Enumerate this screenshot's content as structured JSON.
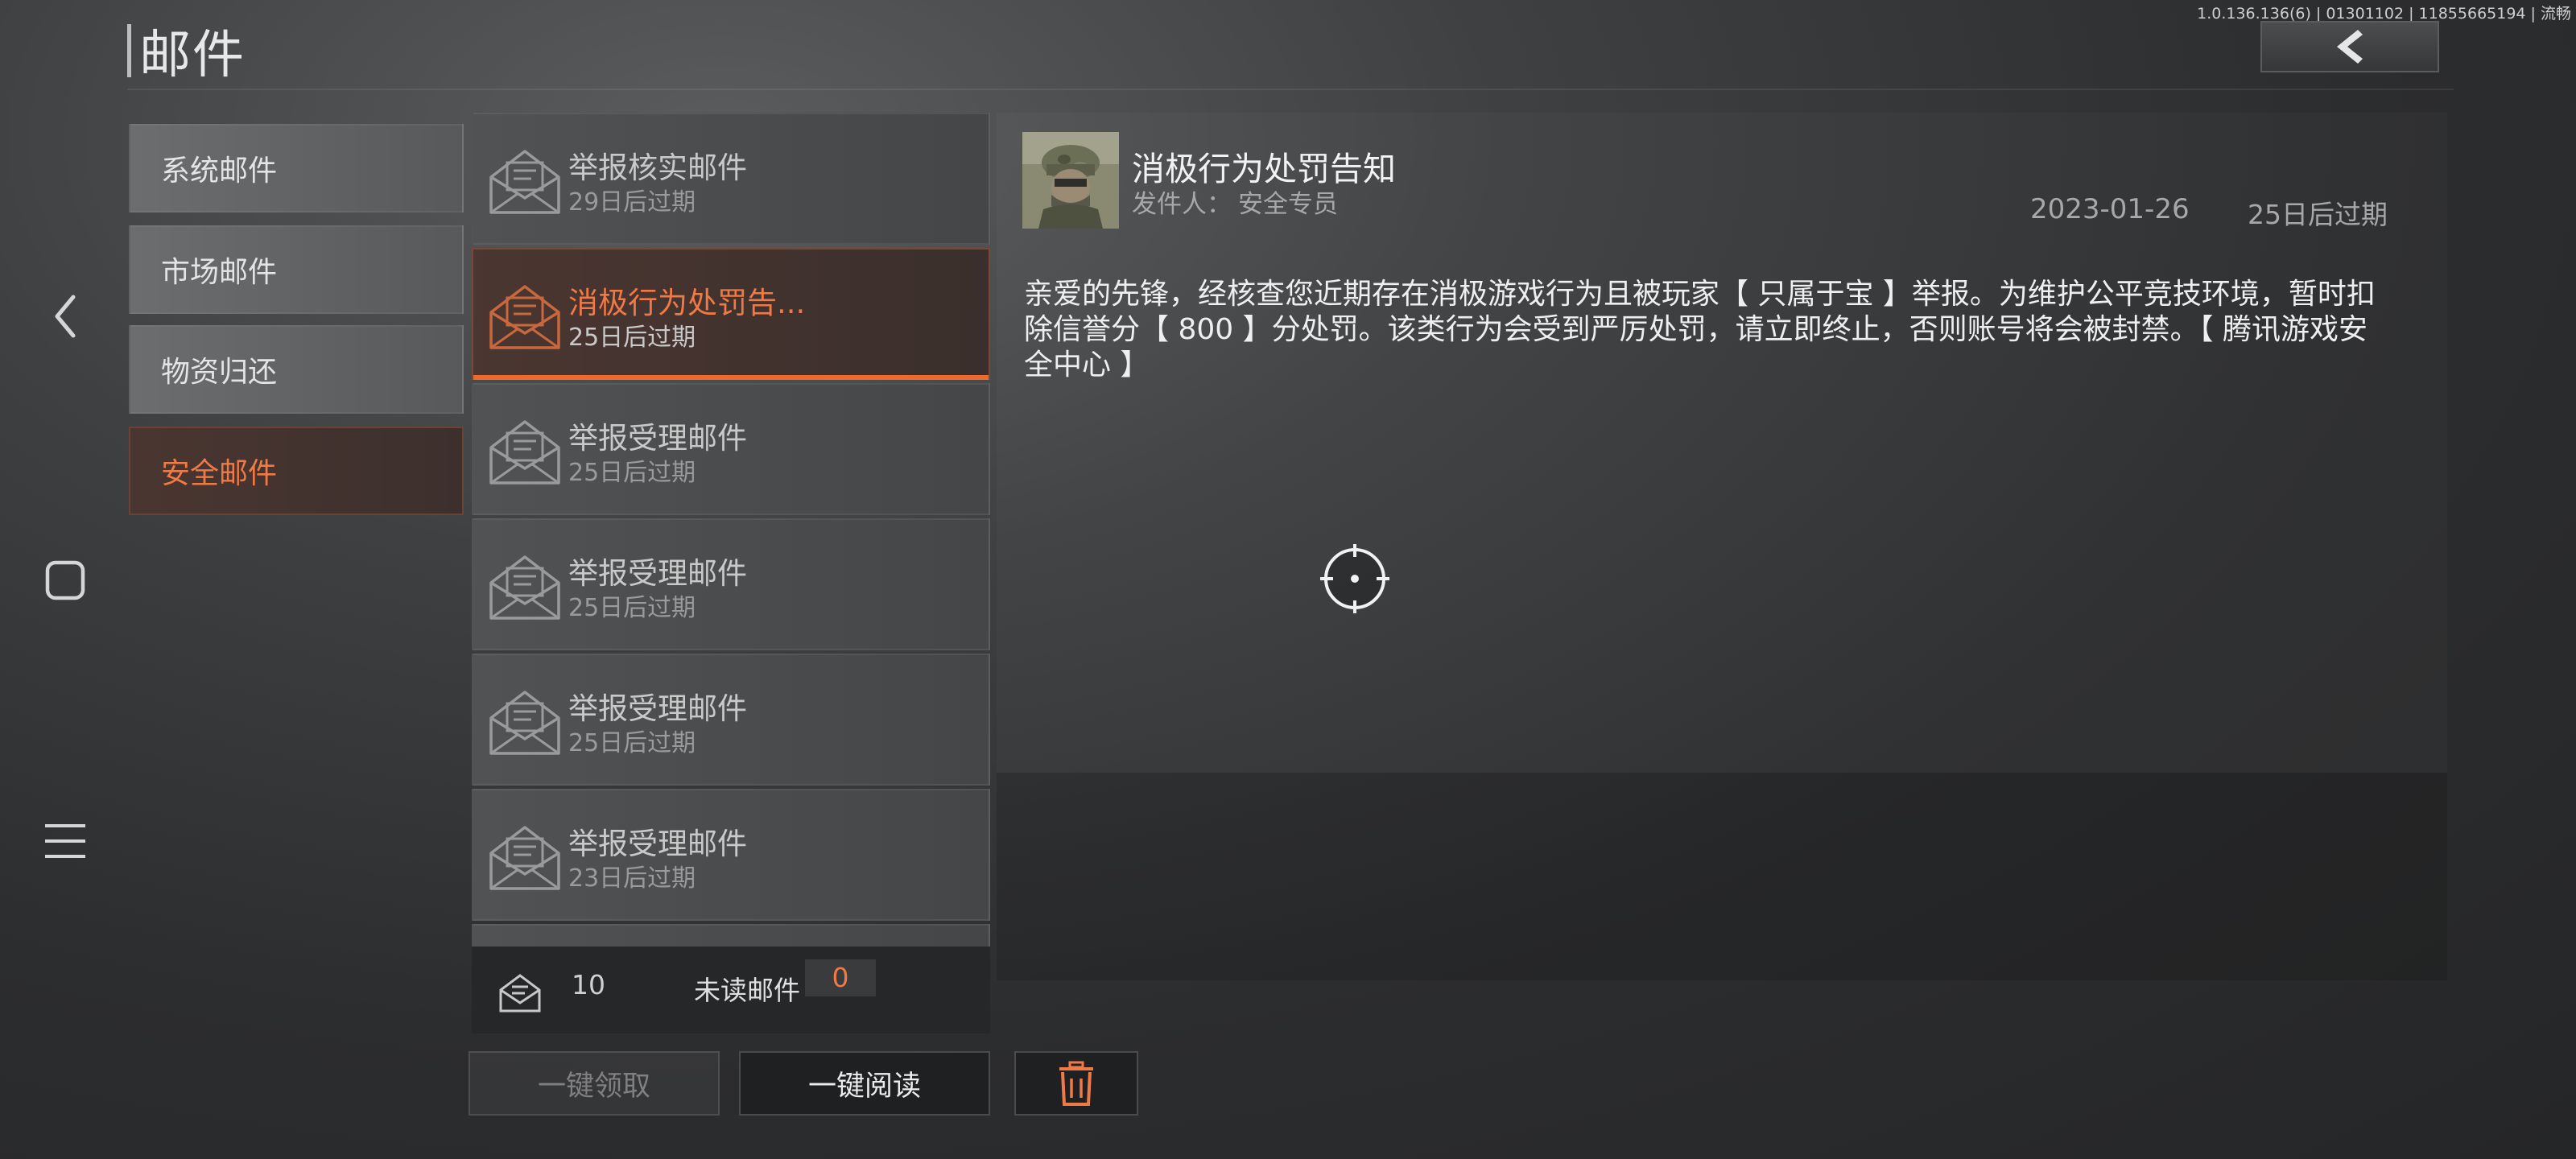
{
  "version_text": "1.0.136.136(6) | 01301102 | 11855665194 | 流畅",
  "page_title": "邮件",
  "categories": [
    {
      "label": "系统邮件",
      "active": false
    },
    {
      "label": "市场邮件",
      "active": false
    },
    {
      "label": "物资归还",
      "active": false
    },
    {
      "label": "安全邮件",
      "active": true
    }
  ],
  "mails": [
    {
      "title": "举报核实邮件",
      "expiry": "29日后过期",
      "active": false
    },
    {
      "title": "消极行为处罚告...",
      "expiry": "25日后过期",
      "active": true
    },
    {
      "title": "举报受理邮件",
      "expiry": "25日后过期",
      "active": false
    },
    {
      "title": "举报受理邮件",
      "expiry": "25日后过期",
      "active": false
    },
    {
      "title": "举报受理邮件",
      "expiry": "25日后过期",
      "active": false
    },
    {
      "title": "举报受理邮件",
      "expiry": "23日后过期",
      "active": false
    }
  ],
  "footer": {
    "total_count": "10",
    "unread_label": "未读邮件",
    "unread_count": "0"
  },
  "buttons": {
    "claim_all": "一键领取",
    "read_all": "一键阅读"
  },
  "detail": {
    "title": "消极行为处罚告知",
    "sender_label": "发件人：",
    "sender_name": "安全专员",
    "date": "2023-01-26",
    "expiry": "25日后过期",
    "body": "亲爱的先锋，经核查您近期存在消极游戏行为且被玩家【 只属于宝 】举报。为维护公平竞技环境，暂时扣除信誉分【 800 】分处罚。该类行为会受到严厉处罚，请立即终止，否则账号将会被封禁。【 腾讯游戏安全中心 】"
  },
  "colors": {
    "accent": "#f07a45",
    "accent_line": "#ee6a2c"
  },
  "icons": {
    "back": "chevron-left-icon",
    "nav_back": "chevron-left-icon",
    "nav_home": "square-icon",
    "nav_menu": "hamburger-icon",
    "mail": "envelope-icon",
    "delete": "trash-icon",
    "crosshair": "crosshair-icon"
  }
}
